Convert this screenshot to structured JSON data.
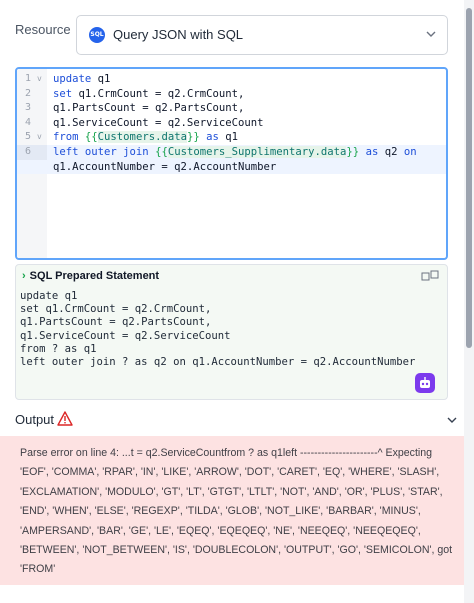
{
  "resource": {
    "label": "Resource",
    "icon_text": "SQL",
    "selected": "Query JSON with SQL"
  },
  "editor": {
    "lines": [
      {
        "num": "1",
        "fold": "v"
      },
      {
        "num": "2",
        "fold": ""
      },
      {
        "num": "3",
        "fold": ""
      },
      {
        "num": "4",
        "fold": ""
      },
      {
        "num": "5",
        "fold": "v"
      },
      {
        "num": "6",
        "fold": ""
      }
    ],
    "code": {
      "l1_kw": "update",
      "l1_rest": " q1",
      "l2_kw": "set",
      "l2_rest": " q1.CrmCount = q2.CrmCount,",
      "l3": "q1.PartsCount = q2.PartsCount,",
      "l4": "q1.ServiceCount = q2.ServiceCount",
      "l5_kw": "from",
      "l5_open": "{{",
      "l5_tpl": "Customers.data",
      "l5_close": "}}",
      "l5_as": "as",
      "l5_alias": " q1",
      "l6_kw": "left outer join",
      "l6_open": "{{",
      "l6_tpl": "Customers_Supplimentary.data",
      "l6_close": "}}",
      "l6_as": "as",
      "l6_alias": " q2 ",
      "l6_on": "on",
      "l6_cont": "q1.AccountNumber = q2.AccountNumber"
    }
  },
  "prepared": {
    "title": "SQL Prepared Statement",
    "lines": [
      "update q1",
      "set q1.CrmCount = q2.CrmCount,",
      "q1.PartsCount = q2.PartsCount,",
      "q1.ServiceCount = q2.ServiceCount",
      "from ? as q1",
      "left outer join ? as q2 on q1.AccountNumber = q2.AccountNumber"
    ]
  },
  "output": {
    "title": "Output",
    "error": "Parse error on line 4: ...t = q2.ServiceCountfrom ? as q1left ----------------------^ Expecting 'EOF', 'COMMA', 'RPAR', 'IN', 'LIKE', 'ARROW', 'DOT', 'CARET', 'EQ', 'WHERE', 'SLASH', 'EXCLAMATION', 'MODULO', 'GT', 'LT', 'GTGT', 'LTLT', 'NOT', 'AND', 'OR', 'PLUS', 'STAR', 'END', 'WHEN', 'ELSE', 'REGEXP', 'TILDA', 'GLOB', 'NOT_LIKE', 'BARBAR', 'MINUS', 'AMPERSAND', 'BAR', 'GE', 'LE', 'EQEQ', 'EQEQEQ', 'NE', 'NEEQEQ', 'NEEQEQEQ', 'BETWEEN', 'NOT_BETWEEN', 'IS', 'DOUBLECOLON', 'OUTPUT', 'GO', 'SEMICOLON', got 'FROM'"
  },
  "colors": {
    "accent": "#60a5fa",
    "keyword": "#1d4ed8",
    "error_bg": "#fde2e2",
    "bot": "#7c3aed"
  }
}
